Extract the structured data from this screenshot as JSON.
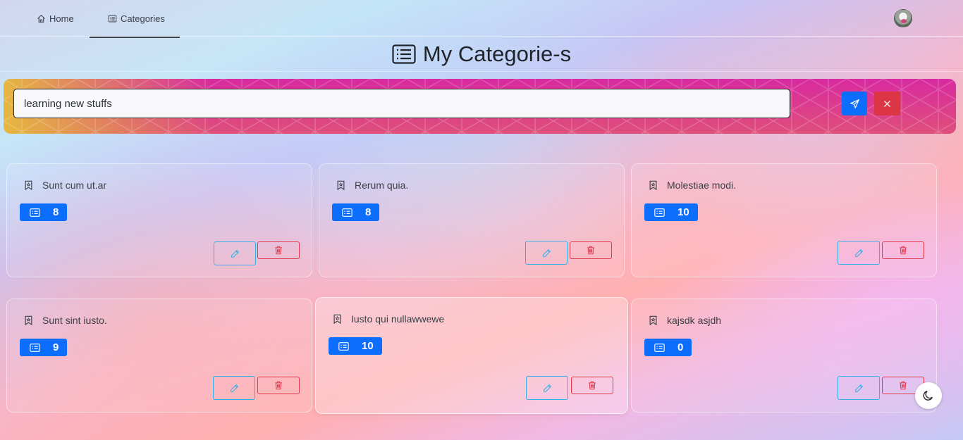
{
  "nav": {
    "home_label": "Home",
    "categories_label": "Categories"
  },
  "page": {
    "title": "My Categorie-s"
  },
  "form": {
    "input_value": "learning new stuffs"
  },
  "colors": {
    "primary": "#0d6efd",
    "danger": "#dc3545",
    "info": "#31b0e8"
  },
  "cards": [
    {
      "title": "Sunt cum ut.ar",
      "count": "8"
    },
    {
      "title": "Rerum quia.",
      "count": "8"
    },
    {
      "title": "Molestiae modi.",
      "count": "10"
    },
    {
      "title": "Sunt sint iusto.",
      "count": "9"
    },
    {
      "title": "Iusto qui nullawwewe",
      "count": "10"
    },
    {
      "title": "kajsdk asjdh",
      "count": "0"
    }
  ],
  "icons": {
    "home": "house-icon",
    "categories": "list-icon",
    "card": "bookmark-icon",
    "count": "card-list-icon",
    "edit": "pencil-icon",
    "delete": "trash-icon",
    "send": "send-icon",
    "cancel": "close-icon",
    "theme": "moon-icon"
  }
}
